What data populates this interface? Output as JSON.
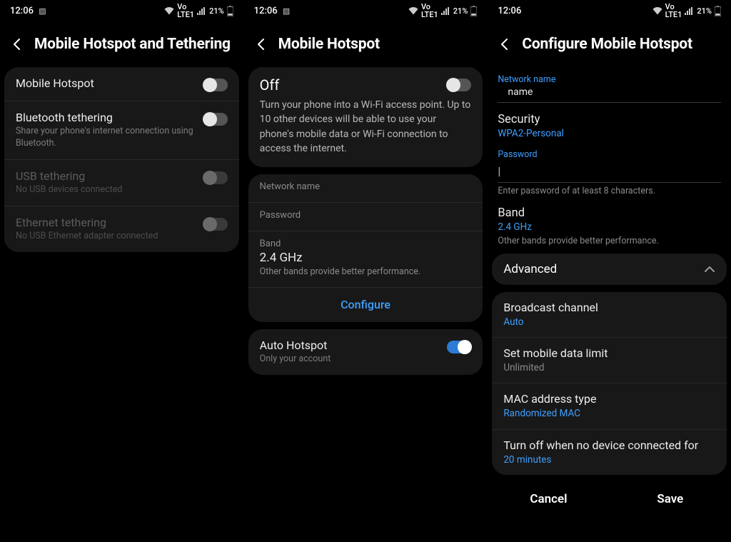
{
  "status": {
    "time": "12:06",
    "battery": "21%",
    "net1": "Vo",
    "net2": "LTE1"
  },
  "s1": {
    "title": "Mobile Hotspot and Tethering",
    "items": [
      {
        "label": "Mobile Hotspot",
        "sub": ""
      },
      {
        "label": "Bluetooth tethering",
        "sub": "Share your phone's internet connection using Bluetooth."
      },
      {
        "label": "USB tethering",
        "sub": "No USB devices connected"
      },
      {
        "label": "Ethernet tethering",
        "sub": "No USB Ethernet adapter connected"
      }
    ]
  },
  "s2": {
    "title": "Mobile Hotspot",
    "state": "Off",
    "desc": "Turn your phone into a Wi-Fi access point. Up to 10 other devices will be able to use your phone's mobile data or Wi-Fi connection to access the internet.",
    "network_label": "Network name",
    "password_label": "Password",
    "band_label": "Band",
    "band_value": "2.4 GHz",
    "band_hint": "Other bands provide better performance.",
    "configure": "Configure",
    "auto_label": "Auto Hotspot",
    "auto_sub": "Only your account"
  },
  "s3": {
    "title": "Configure Mobile Hotspot",
    "net_label": "Network name",
    "net_value": "name",
    "sec_label": "Security",
    "sec_value": "WPA2-Personal",
    "pw_label": "Password",
    "pw_hint": "Enter password of at least 8 characters.",
    "band_label": "Band",
    "band_value": "2.4 GHz",
    "band_hint": "Other bands provide better performance.",
    "advanced": "Advanced",
    "adv": [
      {
        "label": "Broadcast channel",
        "sub": "Auto"
      },
      {
        "label": "Set mobile data limit",
        "sub": "Unlimited"
      },
      {
        "label": "MAC address type",
        "sub": "Randomized MAC"
      },
      {
        "label": "Turn off when no device connected for",
        "sub": "20 minutes"
      }
    ],
    "cancel": "Cancel",
    "save": "Save"
  }
}
